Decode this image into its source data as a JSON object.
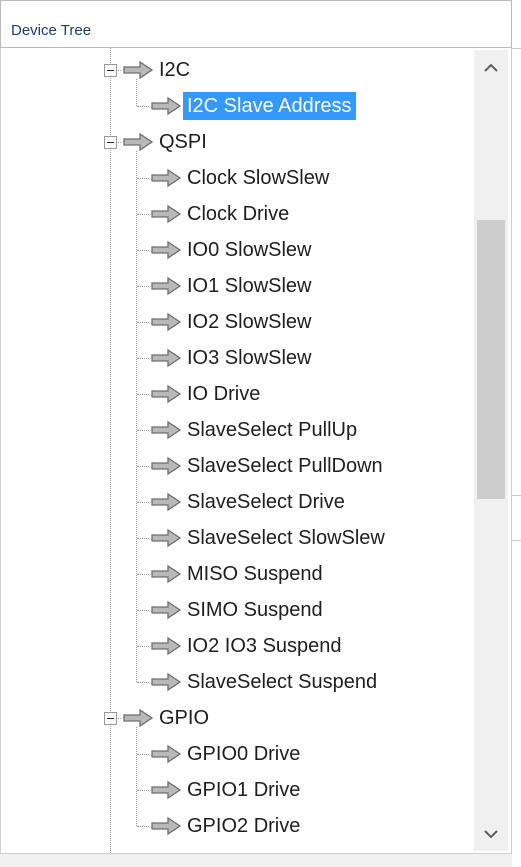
{
  "panel": {
    "title": "Device Tree"
  },
  "tree": {
    "selected_index": 1,
    "items": [
      {
        "label": "I2C",
        "level": 1,
        "expanded": true
      },
      {
        "label": "I2C Slave Address",
        "level": 2
      },
      {
        "label": "QSPI",
        "level": 1,
        "expanded": true
      },
      {
        "label": "Clock SlowSlew",
        "level": 2
      },
      {
        "label": "Clock Drive",
        "level": 2
      },
      {
        "label": "IO0 SlowSlew",
        "level": 2
      },
      {
        "label": "IO1 SlowSlew",
        "level": 2
      },
      {
        "label": "IO2 SlowSlew",
        "level": 2
      },
      {
        "label": "IO3 SlowSlew",
        "level": 2
      },
      {
        "label": "IO Drive",
        "level": 2
      },
      {
        "label": "SlaveSelect PullUp",
        "level": 2
      },
      {
        "label": "SlaveSelect PullDown",
        "level": 2
      },
      {
        "label": "SlaveSelect Drive",
        "level": 2
      },
      {
        "label": "SlaveSelect SlowSlew",
        "level": 2
      },
      {
        "label": "MISO Suspend",
        "level": 2
      },
      {
        "label": "SIMO Suspend",
        "level": 2
      },
      {
        "label": "IO2 IO3 Suspend",
        "level": 2
      },
      {
        "label": "SlaveSelect Suspend",
        "level": 2
      },
      {
        "label": "GPIO",
        "level": 1,
        "expanded": true
      },
      {
        "label": "GPIO0 Drive",
        "level": 2
      },
      {
        "label": "GPIO1 Drive",
        "level": 2
      },
      {
        "label": "GPIO2 Drive",
        "level": 2
      }
    ]
  },
  "scrollbar": {
    "thumb_start_fraction": 0.186,
    "thumb_length_fraction": 0.38
  },
  "icons": {
    "node": "arrow-right-icon",
    "expander": "collapse-minus-icon",
    "scroll_up": "scroll-up-arrow-icon",
    "scroll_down": "scroll-down-arrow-icon"
  },
  "colors": {
    "selection": "#3399ff",
    "selected_text": "#ffffff",
    "header_text": "#1a3d6e",
    "arrow_fill": "#b8b8b8",
    "arrow_outline": "#6f6f6f"
  }
}
